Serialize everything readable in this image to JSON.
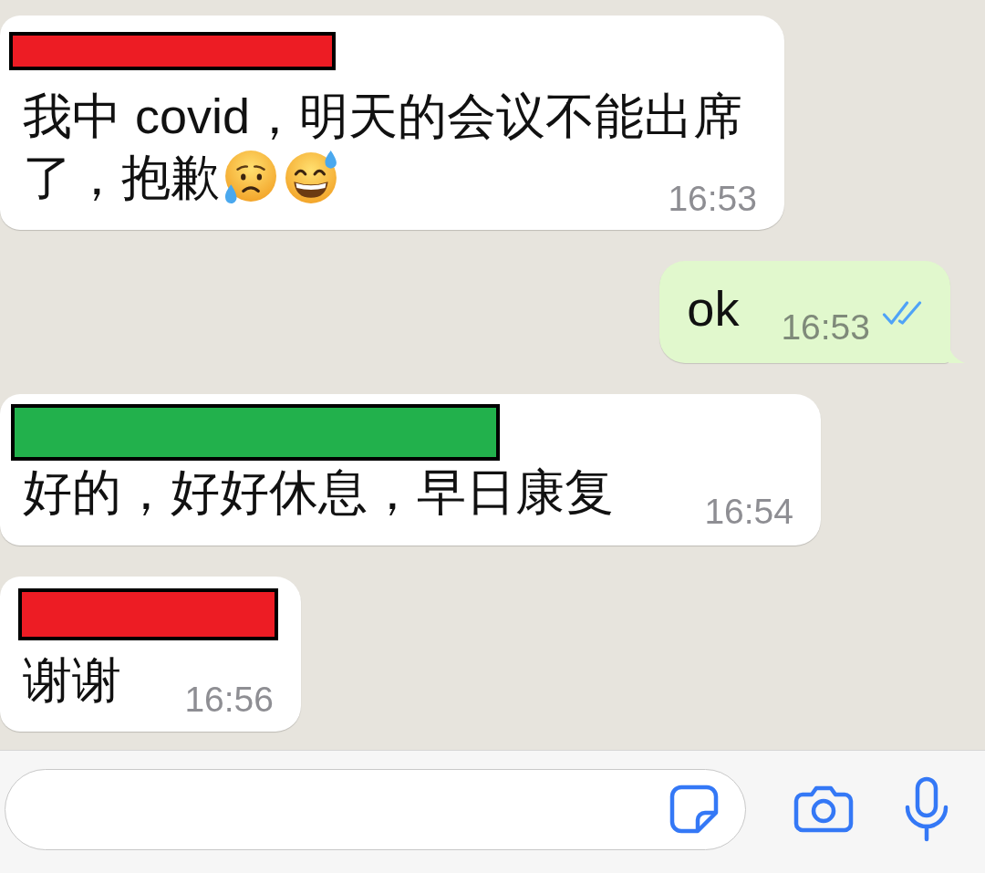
{
  "messages": [
    {
      "kind": "incoming",
      "sender_redaction": {
        "color": "#ed1c24"
      },
      "text_lines": [
        "我中 covid，明天的会议不能出席",
        "了，抱歉"
      ],
      "emojis": [
        {
          "kind": "sad_sweat"
        },
        {
          "kind": "grin_sweat"
        }
      ],
      "time": "16:53"
    },
    {
      "kind": "outgoing",
      "text": "ok",
      "time": "16:53",
      "read": true
    },
    {
      "kind": "incoming",
      "sender_redaction": {
        "color": "#22b14c"
      },
      "text": "好的，好好休息，早日康复",
      "time": "16:54"
    },
    {
      "kind": "incoming",
      "sender_redaction": {
        "color": "#ed1c24"
      },
      "text": "谢谢",
      "time": "16:56"
    }
  ]
}
